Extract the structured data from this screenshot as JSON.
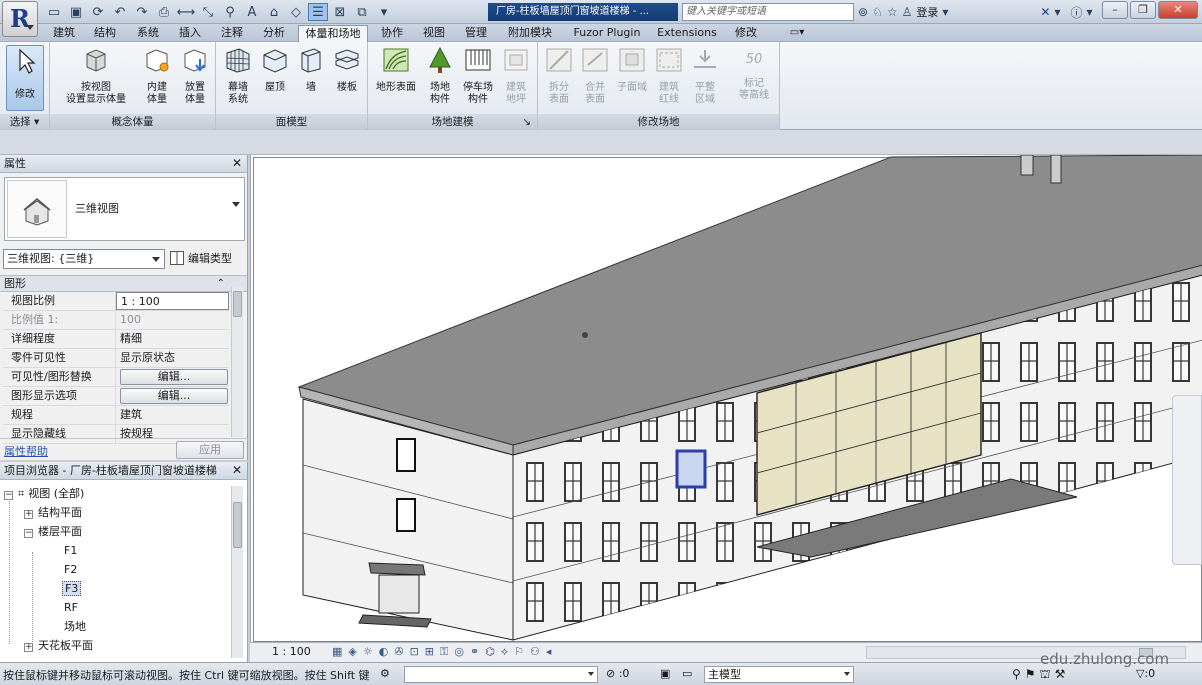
{
  "app": {
    "logo": "R",
    "document_title": "厂房-柱板墙屋顶门窗坡道楼梯 - ...",
    "search_placeholder": "键入关键字或短语",
    "login": "登录"
  },
  "tabs": [
    "建筑",
    "结构",
    "系统",
    "插入",
    "注释",
    "分析",
    "体量和场地",
    "协作",
    "视图",
    "管理",
    "附加模块",
    "Fuzor Plugin",
    "Extensions",
    "修改"
  ],
  "active_tab": "体量和场地",
  "ribbon": {
    "select_label": "选择",
    "modify_label": "修改",
    "panels": {
      "conceptual_mass": {
        "title": "概念体量",
        "show_mass": "按视图\n设置显示体量",
        "inplace_mass": "内建\n体量",
        "place_mass": "放置\n体量"
      },
      "face_model": {
        "title": "面模型",
        "curtain_system": "幕墙\n系统",
        "roof": "屋顶",
        "wall": "墙",
        "floor": "楼板"
      },
      "site_model": {
        "title": "场地建模",
        "toposurface": "地形表面",
        "site_component": "场地\n构件",
        "parking_component": "停车场\n构件",
        "building_pad": "建筑\n地坪"
      },
      "modify_site": {
        "title": "修改场地",
        "split_surface": "拆分\n表面",
        "merge_surfaces": "合并\n表面",
        "subregion": "子面域",
        "property_line": "建筑\n红线",
        "graded_region": "平整\n区域",
        "label_contours": "标记\n等高线",
        "label_contours_value": "50"
      }
    }
  },
  "properties": {
    "title": "属性",
    "type_name": "三维视图",
    "instance_selector": "三维视图: {三维}",
    "edit_type": "编辑类型",
    "group": "图形",
    "rows": [
      {
        "key": "视图比例",
        "value": "1 : 100",
        "style": "box"
      },
      {
        "key": "比例值 1:",
        "value": "100",
        "style": "dim"
      },
      {
        "key": "详细程度",
        "value": "精细",
        "style": ""
      },
      {
        "key": "零件可见性",
        "value": "显示原状态",
        "style": ""
      },
      {
        "key": "可见性/图形替换",
        "value": "编辑...",
        "style": "button"
      },
      {
        "key": "图形显示选项",
        "value": "编辑...",
        "style": "button"
      },
      {
        "key": "规程",
        "value": "建筑",
        "style": ""
      },
      {
        "key": "显示隐藏线",
        "value": "按规程",
        "style": ""
      }
    ],
    "help_link": "属性帮助",
    "apply": "应用"
  },
  "browser": {
    "title": "项目浏览器 - 厂房-柱板墙屋顶门窗坡道楼梯",
    "items": [
      {
        "label": "视图 (全部)",
        "expander": "−",
        "level": 0
      },
      {
        "label": "结构平面",
        "expander": "+",
        "level": 1
      },
      {
        "label": "楼层平面",
        "expander": "−",
        "level": 1
      },
      {
        "label": "F1",
        "expander": "",
        "level": 2
      },
      {
        "label": "F2",
        "expander": "",
        "level": 2
      },
      {
        "label": "F3",
        "expander": "",
        "level": 2,
        "selected": true
      },
      {
        "label": "RF",
        "expander": "",
        "level": 2
      },
      {
        "label": "场地",
        "expander": "",
        "level": 2
      },
      {
        "label": "天花板平面",
        "expander": "+",
        "level": 1
      }
    ]
  },
  "viewbar": {
    "scale": "1 : 100"
  },
  "status": {
    "message": "按住鼠标键并移动鼠标可滚动视图。按住 Ctrl 键可缩放视图。按住 Shift 键",
    "selection_count": ":0",
    "model": "主模型",
    "filter_count": ":0"
  },
  "watermark": "edu.zhulong.com",
  "colors": {
    "roof": "#8c8c8c",
    "wall": "#f2f2f2",
    "glass": "#e8e2c4",
    "active_tab_bg": "#f3f5f8",
    "title_bar": "#c3cedd"
  }
}
